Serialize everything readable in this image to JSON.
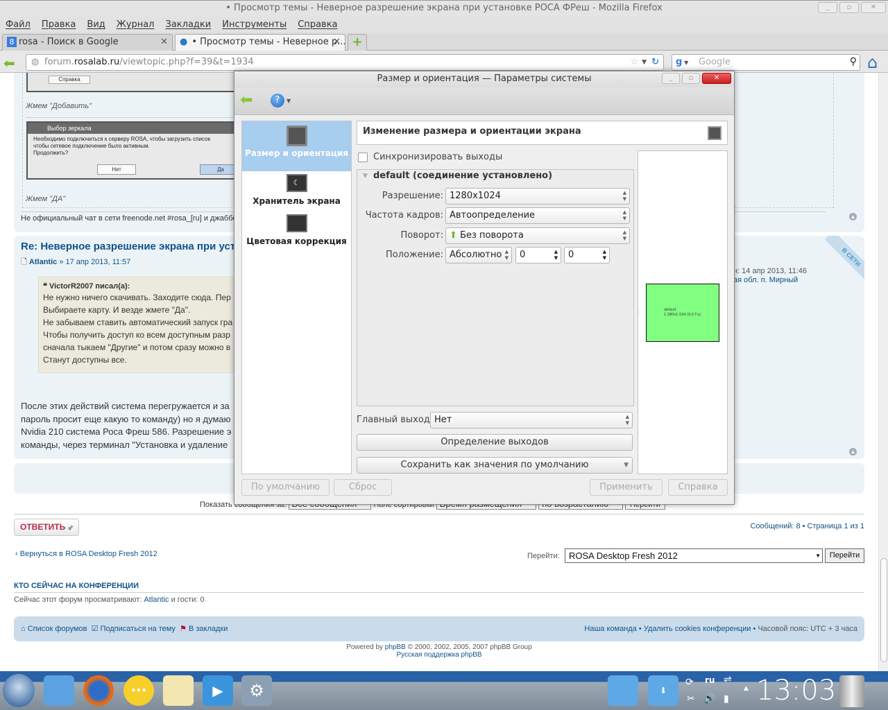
{
  "window": {
    "title": "• Просмотр темы - Неверное разрешение экрана при установке РОСА ФРеш - Mozilla Firefox"
  },
  "menu": [
    "Файл",
    "Правка",
    "Вид",
    "Журнал",
    "Закладки",
    "Инструменты",
    "Справка"
  ],
  "tabs": [
    {
      "label": "rosa - Поиск в Google"
    },
    {
      "label": "• Просмотр темы - Неверное р..."
    }
  ],
  "nav": {
    "url_prefix": "forum.",
    "url_domain": "rosalab.ru",
    "url_path": "/viewtopic.php?f=39&t=1934",
    "search_placeholder": "Google"
  },
  "post1": {
    "img_button": "Справка",
    "caption1": "Жмем \"Добавить\"",
    "dialog_title": "Выбор зеркала",
    "dialog_text": [
      "Необходимо подключиться к серверу ROSA, чтобы загрузить список",
      "чтобы сетевое подключение было активным.",
      "Продолжить?"
    ],
    "no": "Нет",
    "yes": "Да",
    "caption2": "Жмем \"ДА\"",
    "signature": "Не официальный чат в сети freenode.net #rosa_[ru] и джаббе"
  },
  "post2": {
    "title": "Re: Неверное разрешение экрана при уста",
    "author": "Atlantic",
    "date": "» 17 апр 2013, 11:57",
    "quote_author": "VictorR2007 писал(а):",
    "quote_lines": [
      "Не нужно ничего скачивать. Заходите сюда. Пер",
      "Выбираете карту. И везде жмете \"Да\".",
      "Не забываем ставить автоматический запуск гра",
      "Чтобы получить доступ ко всем доступным разр",
      "сначала тыкаем \"Другие\" и потом сразу можно в",
      "Станут доступны все."
    ],
    "body": [
      "После этих действий система перегружается и за",
      "пароль просит еще какую то команду) но я думаю",
      "Nvidia 210 система Роса Фреш 586. Разрешение э",
      "команды, через терминал \"Установка и удаление"
    ],
    "online_badge": "В СЕТИ",
    "profile_lines": [
      "н: 14 апр 2013, 11:46",
      "ая обл. п. Мирный"
    ]
  },
  "sort": {
    "label": "Показать сообщения за:",
    "v1": "Все сообщения",
    "label2": "Поле сортировки",
    "v2": "Время размещения",
    "v3": "по возрастанию",
    "go": "Перейти"
  },
  "reply": "ОТВЕТИТЬ",
  "pagination": "Сообщений: 8 • Страница 1 из 1",
  "back_link": "Вернуться в ROSA Desktop Fresh 2012",
  "jump": {
    "label": "Перейти:",
    "value": "ROSA Desktop Fresh 2012",
    "button": "Перейти"
  },
  "who": {
    "title": "КТО СЕЙЧАС НА КОНФЕРЕНЦИИ",
    "text": "Сейчас этот форум просматривают:",
    "user": "Atlantic",
    "guests": "и гости: 0"
  },
  "footer": {
    "forums": "Список форумов",
    "subscribe": "Подписаться на тему",
    "bookmark": "В закладки",
    "team": "Наша команда",
    "cookies": "Удалить cookies конференции",
    "tz": "Часовой пояс: UTC + 3 часа",
    "powered": "Powered by",
    "phpbb": "phpBB",
    "copy": "© 2000, 2002, 2005, 2007 phpBB Group",
    "ru": "Русская поддержка phpBB"
  },
  "dialog": {
    "title": "Размер и ориентация — Параметры системы",
    "modules": [
      {
        "label": "Размер и ориентация"
      },
      {
        "label": "Хранитель экрана"
      },
      {
        "label": "Цветовая коррекция"
      }
    ],
    "header": "Изменение размера и ориентации экрана",
    "sync": "Синхронизировать выходы",
    "output": "default (соединение установлено)",
    "resolution_label": "Разрешение:",
    "resolution": "1280x1024",
    "refresh_label": "Частота кадров:",
    "refresh": "Автоопределение",
    "rotation_label": "Поворот:",
    "rotation": "Без поворота",
    "position_label": "Положение:",
    "position": "Абсолютно",
    "pos_x": "0",
    "pos_y": "0",
    "primary_label": "Главный выход:",
    "primary": "Нет",
    "detect": "Определение выходов",
    "save_default": "Сохранить как значения по умолчанию",
    "preview_name": "default",
    "preview_mode": "1 280x1 024 (0,0 Гц)",
    "defaults": "По умолчанию",
    "reset": "Сброс",
    "apply": "Применить",
    "help": "Справка"
  },
  "taskbar": {
    "lang": "ru",
    "clock": "13:03"
  }
}
